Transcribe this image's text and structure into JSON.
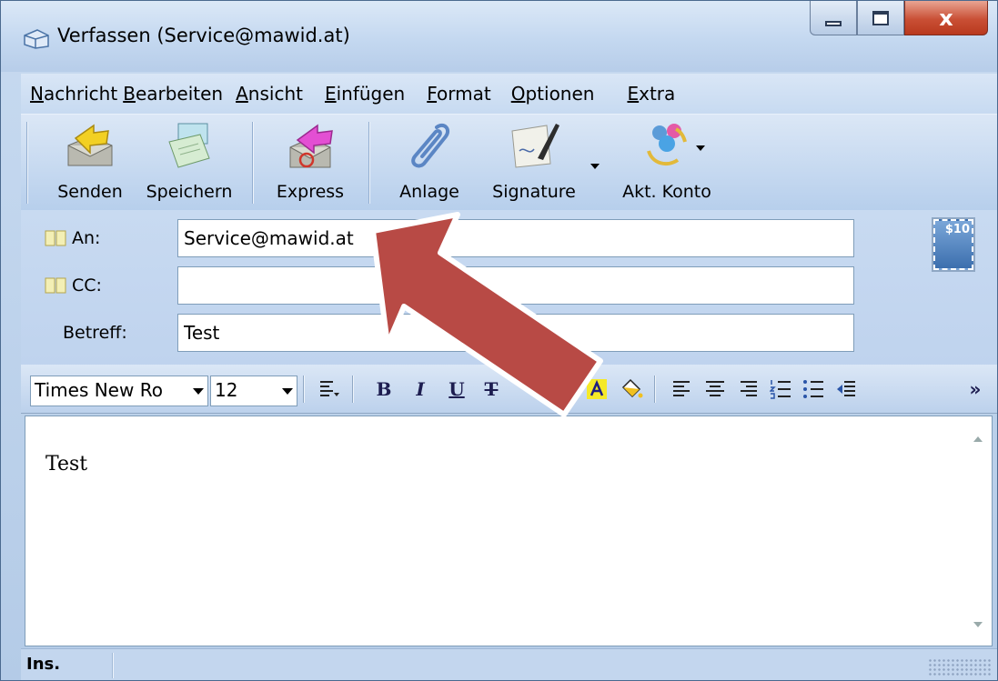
{
  "window": {
    "title": "Verfassen (Service@mawid.at)",
    "close_glyph": "x"
  },
  "menu": [
    {
      "label": "Nachricht",
      "accel": "N",
      "rest": "achricht"
    },
    {
      "label": "Bearbeiten",
      "accel": "B",
      "rest": "earbeiten"
    },
    {
      "label": "Ansicht",
      "accel": "A",
      "rest": "nsicht"
    },
    {
      "label": "Einfügen",
      "accel": "E",
      "rest": "infügen"
    },
    {
      "label": "Format",
      "accel": "F",
      "rest": "ormat"
    },
    {
      "label": "Optionen",
      "accel": "O",
      "rest": "ptionen"
    },
    {
      "label": "Extra",
      "accel": "E",
      "rest": "xtra"
    }
  ],
  "toolbar": {
    "send": "Senden",
    "save": "Speichern",
    "express": "Express",
    "attach": "Anlage",
    "signature": "Signature",
    "account": "Akt. Konto"
  },
  "fields": {
    "to_label": "An:",
    "to_value": "Service@mawid.at",
    "cc_label": "CC:",
    "cc_value": "",
    "subject_label": "Betreff:",
    "subject_value": "Test",
    "stamp_text": "$10"
  },
  "format": {
    "font_name": "Times New Ro",
    "font_size": "12",
    "bold": "B",
    "italic": "I",
    "underline": "U",
    "strike": "T",
    "more": "»"
  },
  "editor": {
    "body_text": "Test"
  },
  "status": {
    "mode": "Ins."
  },
  "colors": {
    "arrow_fill": "#b84a45",
    "arrow_stroke": "#ffffff"
  }
}
